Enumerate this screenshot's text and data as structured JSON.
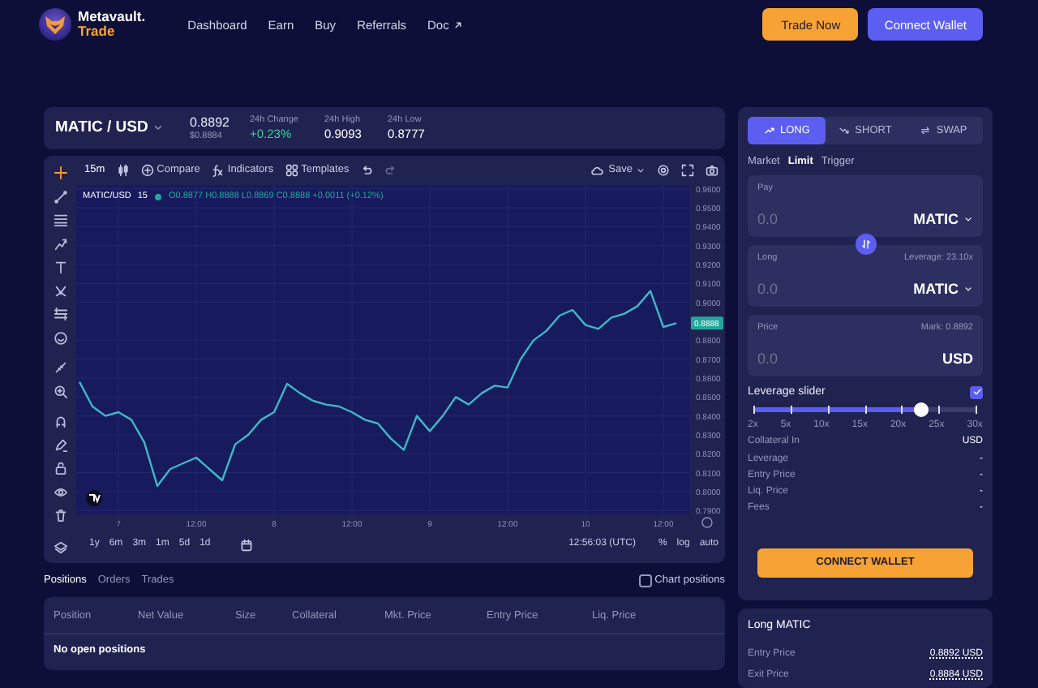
{
  "header": {
    "brand": "Metavault.",
    "brand_sub": "Trade",
    "nav": [
      {
        "label": "Dashboard",
        "external": false
      },
      {
        "label": "Earn",
        "external": false
      },
      {
        "label": "Buy",
        "external": false
      },
      {
        "label": "Referrals",
        "external": false
      },
      {
        "label": "Doc",
        "external": true
      }
    ],
    "buttons": [
      {
        "label": "Trade Now",
        "kind": "orange"
      },
      {
        "label": "Connect Wallet",
        "kind": "violet"
      }
    ]
  },
  "ticker": {
    "pair": "MATIC / USD",
    "price": "0.8892",
    "price_usd": "$0.8884",
    "stats": [
      {
        "label": "24h Change",
        "value": "+0.23%",
        "positive": true
      },
      {
        "label": "24h High",
        "value": "0.9093",
        "positive": false
      },
      {
        "label": "24h Low",
        "value": "0.8777",
        "positive": false
      }
    ]
  },
  "chart": {
    "toolbar": {
      "interval": "15m",
      "items": [
        {
          "label": "Compare",
          "kind": "compare"
        },
        {
          "label": "Indicators",
          "kind": "indicators"
        },
        {
          "label": "Templates",
          "kind": "templates"
        }
      ],
      "save": "Save"
    },
    "legend": {
      "interval": "15",
      "ohlc": "O0.8877 H0.8888 L0.8869 C0.8888 +0.0011 (+0.12%)"
    },
    "price_tag": "0.8888",
    "chart_data": {
      "type": "line",
      "grid": true,
      "ylim": [
        0.788,
        0.962
      ],
      "categories": [
        null,
        null,
        null,
        "7",
        null,
        null,
        null,
        null,
        null,
        "12:00",
        null,
        null,
        null,
        null,
        null,
        "8",
        null,
        null,
        null,
        null,
        null,
        "12:00",
        null,
        null,
        null,
        null,
        null,
        "9",
        null,
        null,
        null,
        null,
        null,
        "12:00",
        null,
        null,
        null,
        null,
        null,
        "10",
        null,
        null,
        null,
        null,
        null,
        "12:00",
        null
      ],
      "series": [
        {
          "name": "MATIC/USD",
          "color": "#3fb8c8",
          "values": [
            0.858,
            0.845,
            0.84,
            0.842,
            0.838,
            0.826,
            0.803,
            0.812,
            0.815,
            0.818,
            0.812,
            0.806,
            0.825,
            0.83,
            0.838,
            0.842,
            0.857,
            0.852,
            0.848,
            0.846,
            0.845,
            0.842,
            0.838,
            0.836,
            0.828,
            0.822,
            0.84,
            0.832,
            0.84,
            0.85,
            0.846,
            0.852,
            0.856,
            0.855,
            0.87,
            0.88,
            0.885,
            0.893,
            0.896,
            0.888,
            0.886,
            0.892,
            0.894,
            0.898,
            0.906,
            0.887,
            0.889
          ]
        }
      ],
      "yticks": [
        {
          "value": 0.96,
          "label": "0.9600"
        },
        {
          "value": 0.95,
          "label": "0.9500"
        },
        {
          "value": 0.94,
          "label": "0.9400"
        },
        {
          "value": 0.93,
          "label": "0.9300"
        },
        {
          "value": 0.92,
          "label": "0.9200"
        },
        {
          "value": 0.91,
          "label": "0.9100"
        },
        {
          "value": 0.9,
          "label": "0.9000"
        },
        {
          "value": 0.88,
          "label": "0.8800"
        },
        {
          "value": 0.87,
          "label": "0.8700"
        },
        {
          "value": 0.86,
          "label": "0.8600"
        },
        {
          "value": 0.85,
          "label": "0.8500"
        },
        {
          "value": 0.84,
          "label": "0.8400"
        },
        {
          "value": 0.83,
          "label": "0.8300"
        },
        {
          "value": 0.82,
          "label": "0.8200"
        },
        {
          "value": 0.81,
          "label": "0.8100"
        },
        {
          "value": 0.8,
          "label": "0.8000"
        },
        {
          "value": 0.79,
          "label": "0.7900"
        }
      ]
    },
    "ranges": [
      "1y",
      "6m",
      "3m",
      "1m",
      "5d",
      "1d"
    ],
    "clock": "12:56:03 (UTC)",
    "options": [
      "%",
      "log",
      "auto"
    ]
  },
  "positions": {
    "tabs": [
      {
        "label": "Positions",
        "selected": true
      },
      {
        "label": "Orders",
        "selected": false
      },
      {
        "label": "Trades",
        "selected": false
      }
    ],
    "chart_positions": {
      "label": "Chart positions",
      "checked": false
    },
    "columns": [
      "Position",
      "Net Value",
      "Size",
      "Collateral",
      "Mkt. Price",
      "Entry Price",
      "Liq. Price"
    ],
    "empty": "No open positions"
  },
  "trade": {
    "modes": [
      {
        "label": "LONG",
        "kind": "long",
        "selected": true
      },
      {
        "label": "SHORT",
        "kind": "short",
        "selected": false
      },
      {
        "label": "SWAP",
        "kind": "swap",
        "selected": false
      }
    ],
    "order_types": [
      {
        "label": "Market",
        "selected": false
      },
      {
        "label": "Limit",
        "selected": true
      },
      {
        "label": "Trigger",
        "selected": false
      }
    ],
    "fields": [
      {
        "label": "Pay",
        "placeholder": "0.0",
        "token": "MATIC",
        "dropdown": true
      },
      {
        "label": "Long",
        "info": "Leverage: 23.10x",
        "placeholder": "0.0",
        "token": "MATIC",
        "dropdown": true
      },
      {
        "label": "Price",
        "info": "Mark: 0.8892",
        "placeholder": "0.0",
        "token": "USD",
        "dropdown": false
      }
    ],
    "leverage": {
      "label": "Leverage slider",
      "checked": true,
      "level": 0.75,
      "marks": [
        "2x",
        "5x",
        "10x",
        "15x",
        "20x",
        "25x",
        "30x"
      ]
    },
    "info": [
      {
        "label": "Collateral In",
        "value": "USD"
      },
      {
        "label": "Leverage",
        "value": "-"
      },
      {
        "label": "Entry Price",
        "value": "-"
      },
      {
        "label": "Liq. Price",
        "value": "-"
      },
      {
        "label": "Fees",
        "value": "-"
      }
    ],
    "button": "CONNECT WALLET"
  },
  "position_card": {
    "title": "Long MATIC",
    "rows": [
      {
        "label": "Entry Price",
        "value": "0.8892 USD"
      },
      {
        "label": "Exit Price",
        "value": "0.8884 USD"
      }
    ]
  }
}
